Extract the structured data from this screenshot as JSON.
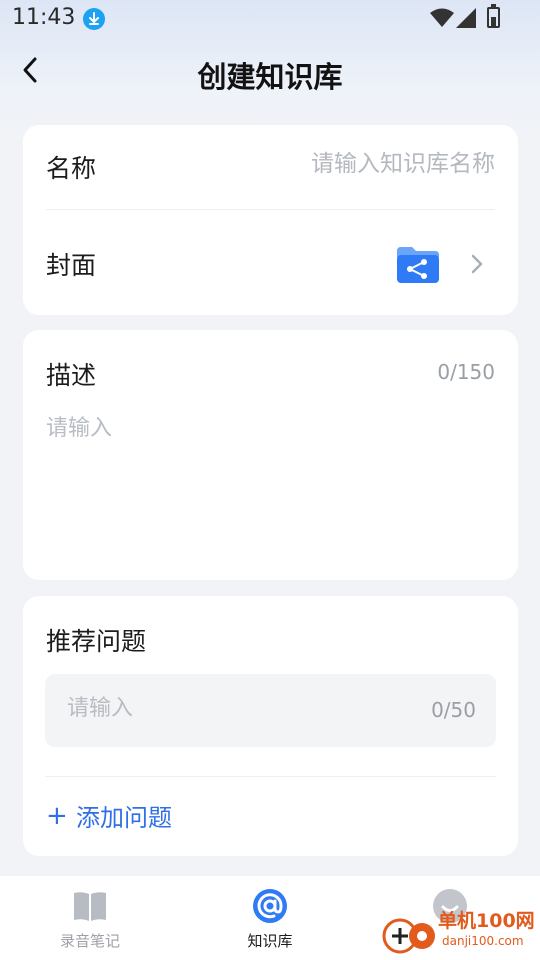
{
  "status_bar": {
    "time": "11:43",
    "icons": [
      "download-icon",
      "wifi-icon",
      "signal-icon",
      "battery-icon"
    ]
  },
  "header": {
    "title": "创建知识库",
    "back_icon": "chevron-left-icon"
  },
  "form": {
    "name": {
      "label": "名称",
      "placeholder": "请输入知识库名称",
      "value": ""
    },
    "cover": {
      "label": "封面",
      "icon": "folder-share-icon",
      "accent": "#2f7bf5"
    },
    "description": {
      "label": "描述",
      "counter": "0/150",
      "placeholder": "请输入",
      "value": ""
    },
    "questions": {
      "label": "推荐问题",
      "placeholder": "请输入",
      "counter": "0/50",
      "value": "",
      "add_label": "添加问题",
      "add_icon": "+"
    }
  },
  "bottom_nav": {
    "items": [
      {
        "label": "录音笔记",
        "icon": "book-icon",
        "active": false
      },
      {
        "label": "知识库",
        "icon": "at-icon",
        "active": true
      },
      {
        "label": "",
        "icon": "avatar-icon",
        "active": false
      }
    ]
  },
  "watermark": {
    "text": "单机100网",
    "sub": "danji100.com"
  },
  "colors": {
    "accent": "#2f6fe8",
    "background": "#f1f3f7",
    "card": "#ffffff",
    "placeholder": "#b4b8bf"
  }
}
